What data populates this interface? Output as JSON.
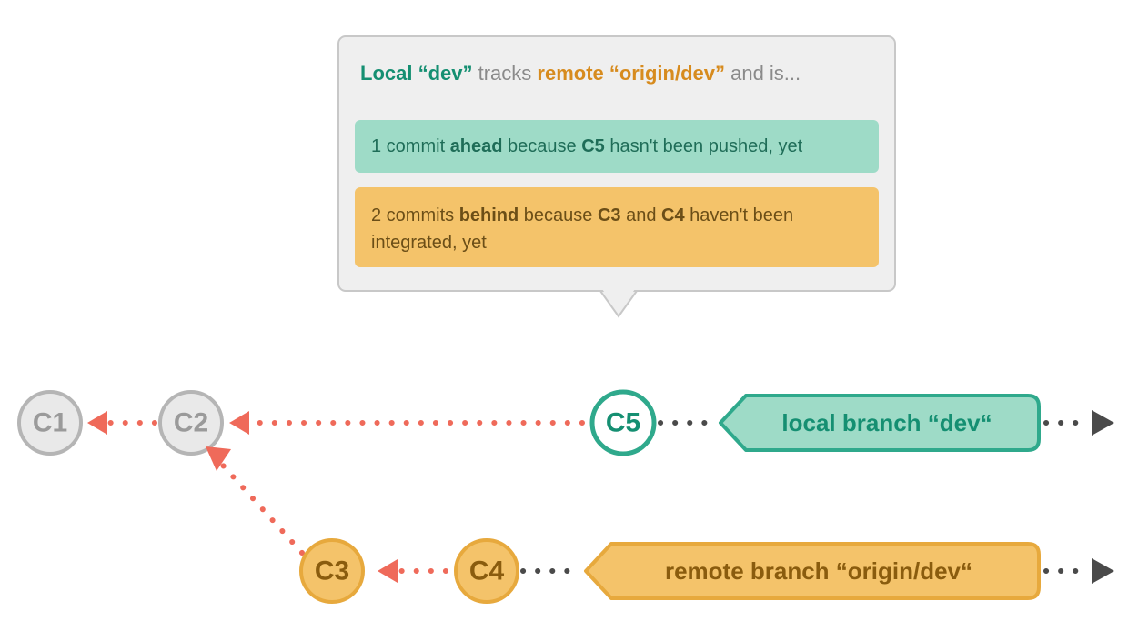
{
  "colors": {
    "gray_fill": "#e9e9e9",
    "gray_stroke": "#b5b5b5",
    "gray_text": "#9a9a9a",
    "teal_fill": "#9edbc7",
    "teal_stroke": "#2fa98c",
    "teal_text": "#158f72",
    "orange_fill": "#f4c36a",
    "orange_stroke": "#e7a93d",
    "orange_text": "#b47a16",
    "connector": "#ef6a5a",
    "dark_arrow": "#4a4a4a",
    "body_text": "#7e7e7e",
    "ahead_text": "#1f6d58",
    "behind_text": "#6b4e17"
  },
  "commits": {
    "c1": "C1",
    "c2": "C2",
    "c3": "C3",
    "c4": "C4",
    "c5": "C5"
  },
  "branches": {
    "local": "local branch “dev“",
    "remote": "remote branch “origin/dev“"
  },
  "callout": {
    "title_local": "Local “dev”",
    "title_tracks": " tracks ",
    "title_remote": "remote “origin/dev”",
    "title_tail": " and is...",
    "ahead_pre": "1 commit ",
    "ahead_bold1": "ahead",
    "ahead_mid": " because ",
    "ahead_bold2": "C5",
    "ahead_post": " hasn't been pushed, yet",
    "behind_pre": "2 commits ",
    "behind_bold1": "behind",
    "behind_mid1": " because ",
    "behind_bold2": "C3",
    "behind_mid2": " and ",
    "behind_bold3": "C4",
    "behind_post1": " haven't been",
    "behind_line2": "integrated, yet"
  }
}
